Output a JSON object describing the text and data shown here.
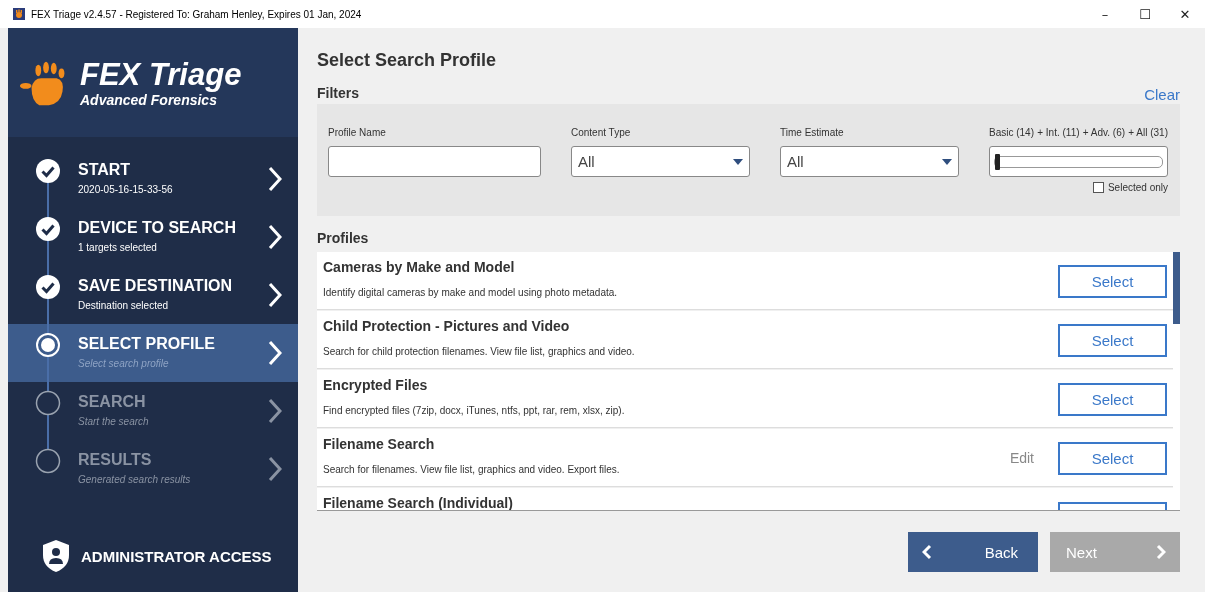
{
  "window": {
    "title": "FEX Triage v2.4.57 - Registered To: Graham Henley, Expires 01 Jan, 2024",
    "controls": [
      "–",
      "☐",
      "✕"
    ]
  },
  "brand": {
    "name": "FEX Triage",
    "tagline": "Advanced Forensics"
  },
  "steps": [
    {
      "title": "START",
      "subtitle": "2020-05-16-15-33-56",
      "kind": "done"
    },
    {
      "title": "DEVICE TO SEARCH",
      "subtitle": "1 targets selected",
      "kind": "done"
    },
    {
      "title": "SAVE DESTINATION",
      "subtitle": "Destination selected",
      "kind": "done"
    },
    {
      "title": "SELECT PROFILE",
      "subtitle": "Select search profile",
      "kind": "current"
    },
    {
      "title": "SEARCH",
      "subtitle": "Start the search",
      "kind": "pending"
    },
    {
      "title": "RESULTS",
      "subtitle": "Generated search results",
      "kind": "pending"
    }
  ],
  "admin": {
    "label": "ADMINISTRATOR ACCESS"
  },
  "heading": "Select Search Profile",
  "filters": {
    "title": "Filters",
    "clear": "Clear",
    "profile_name": {
      "label": "Profile Name"
    },
    "content_type": {
      "label": "Content Type",
      "value": "All"
    },
    "time_estimate": {
      "label": "Time Estimate",
      "value": "All"
    },
    "level_labels": [
      "Basic (14)",
      "+ Int. (11)",
      "+ Adv. (6)",
      "+ All (31)"
    ],
    "level": 0,
    "selected_only": {
      "label": "Selected only",
      "checked": false
    }
  },
  "profiles_title": "Profiles",
  "profiles": [
    {
      "name": "Cameras by Make and Model",
      "description": "Identify digital cameras by make and model using photo metadata.",
      "select": "Select"
    },
    {
      "name": "Child Protection - Pictures and Video",
      "description": "Search for child protection filenames. View file list, graphics and video.",
      "select": "Select"
    },
    {
      "name": "Encrypted Files",
      "description": "Find encrypted files (7zip, docx, iTunes, ntfs, ppt, rar, rem, xlsx, zip).",
      "select": "Select"
    },
    {
      "name": "Filename Search",
      "description": "Search for filenames. View file list, graphics and video. Export files.",
      "edit": "Edit",
      "select": "Select"
    },
    {
      "name": "Filename Search (Individual)"
    }
  ],
  "back": {
    "label": "Back",
    "disabled": false
  },
  "next": {
    "label": "Next",
    "disabled": true
  }
}
